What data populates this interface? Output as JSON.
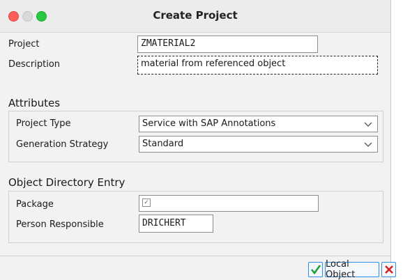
{
  "window": {
    "title": "Create Project"
  },
  "form": {
    "project_label": "Project",
    "project_value": "ZMATERIAL2",
    "description_label": "Description",
    "description_value": "material from referenced object"
  },
  "attributes": {
    "title": "Attributes",
    "project_type_label": "Project Type",
    "project_type_value": "Service with SAP Annotations",
    "generation_strategy_label": "Generation Strategy",
    "generation_strategy_value": "Standard"
  },
  "object_directory": {
    "title": "Object Directory Entry",
    "package_label": "Package",
    "package_value": "",
    "person_label": "Person Responsible",
    "person_value": "DRICHERT"
  },
  "buttons": {
    "local_object_label": "Local Object"
  },
  "icons": {
    "confirm": "checkmark-icon",
    "cancel": "close-icon",
    "dropdown": "chevron-down-icon"
  },
  "colors": {
    "accent": "#2f8ee8",
    "confirm_green": "#1e9e3a",
    "cancel_red": "#d81f26",
    "close_light": "#fe5f57",
    "max_light": "#28c840"
  }
}
